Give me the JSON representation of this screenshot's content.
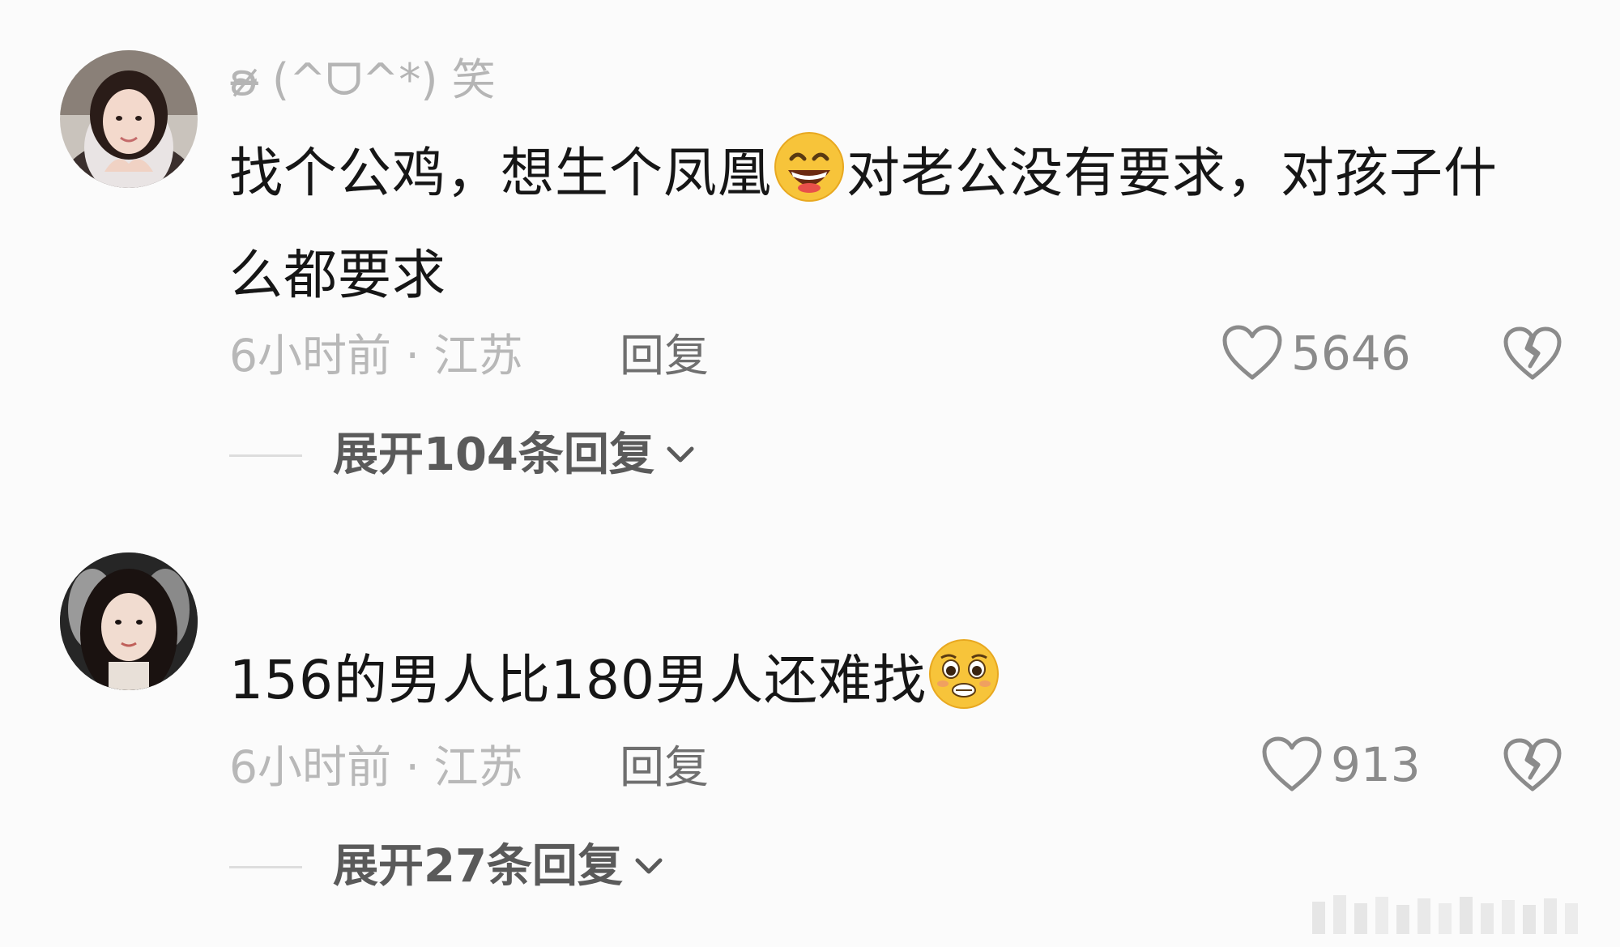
{
  "comments": [
    {
      "username": "ʚ̴̶̷̷ (^ᗜ^*) 笑",
      "text_part1": "找个公鸡，想生个凤凰",
      "emoji1": "grinning-face-emoji",
      "text_part2": "对老公没有要求，对孩子什么都要求",
      "time_location": "6小时前 · 江苏",
      "reply_label": "回复",
      "likes": "5646",
      "expand_label": "展开104条回复"
    },
    {
      "username": "",
      "text_part1": "156的男人比180男人还难找",
      "emoji1": "pleading-face-emoji",
      "time_location": "6小时前 · 江苏",
      "reply_label": "回复",
      "likes": "913",
      "expand_label": "展开27条回复"
    }
  ],
  "colors": {
    "text": "#161616",
    "meta": "#b8b8b8",
    "reply": "#6f6f6f",
    "like": "#8b8b8b",
    "expand": "#5a5a5a",
    "emoji": "#f7c43a"
  },
  "icons": [
    "heart-outline-icon",
    "broken-heart-icon",
    "chevron-down-icon"
  ]
}
